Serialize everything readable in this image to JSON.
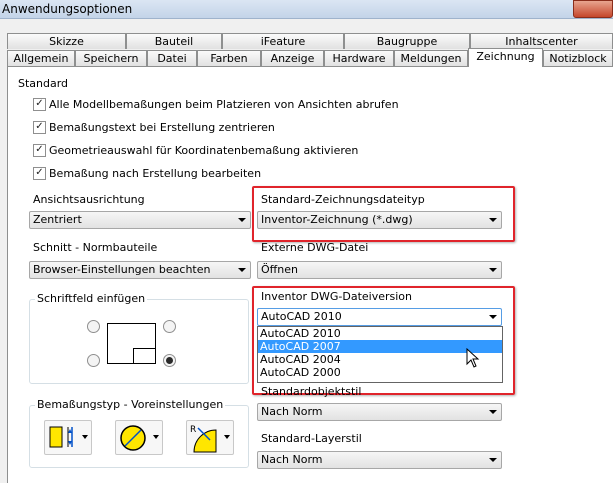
{
  "window": {
    "title": "Anwendungsoptionen"
  },
  "tabs_back": [
    {
      "label": "Skizze"
    },
    {
      "label": "Bauteil"
    },
    {
      "label": "iFeature"
    },
    {
      "label": "Baugruppe"
    },
    {
      "label": "Inhaltscenter"
    }
  ],
  "tabs_front": [
    {
      "label": "Allgemein"
    },
    {
      "label": "Speichern"
    },
    {
      "label": "Datei"
    },
    {
      "label": "Farben"
    },
    {
      "label": "Anzeige"
    },
    {
      "label": "Hardware"
    },
    {
      "label": "Meldungen"
    },
    {
      "label": "Zeichnung"
    },
    {
      "label": "Notizblock"
    }
  ],
  "standard": {
    "heading": "Standard",
    "checkboxes": [
      {
        "label": "Alle Modellbemaßungen beim Platzieren von Ansichten abrufen",
        "checked": true
      },
      {
        "label": "Bemaßungstext bei Erstellung zentrieren",
        "checked": true
      },
      {
        "label": "Geometrieauswahl für Koordinatenbemaßung aktivieren",
        "checked": true
      },
      {
        "label": "Bemaßung nach Erstellung bearbeiten",
        "checked": true
      }
    ]
  },
  "left": {
    "ansichtsausrichtung": {
      "label": "Ansichtsausrichtung",
      "value": "Zentriert"
    },
    "schnitt": {
      "label": "Schnitt - Normbauteile",
      "value": "Browser-Einstellungen beachten"
    },
    "schriftfeld": {
      "label": "Schriftfeld einfügen"
    },
    "bemassungstyp": {
      "label": "Bemaßungstyp - Voreinstellungen"
    }
  },
  "right": {
    "dateityp": {
      "label": "Standard-Zeichnungsdateityp",
      "value": "Inventor-Zeichnung (*.dwg)"
    },
    "extern": {
      "label": "Externe DWG-Datei",
      "value": "Öffnen"
    },
    "dwgversion": {
      "label": "Inventor DWG-Dateiversion",
      "value": "AutoCAD 2010",
      "options": [
        {
          "label": "AutoCAD 2010"
        },
        {
          "label": "AutoCAD 2007"
        },
        {
          "label": "AutoCAD 2004"
        },
        {
          "label": "AutoCAD 2000"
        }
      ],
      "highlighted": "AutoCAD 2007"
    },
    "objektstil": {
      "label": "Standardobjektstil",
      "value": "Nach Norm"
    },
    "layerstil": {
      "label": "Standard-Layerstil",
      "value": "Nach Norm"
    }
  },
  "colors": {
    "highlight": "#3399ff",
    "annotation_red": "#e0242b",
    "icon_yellow": "#ffe600"
  }
}
